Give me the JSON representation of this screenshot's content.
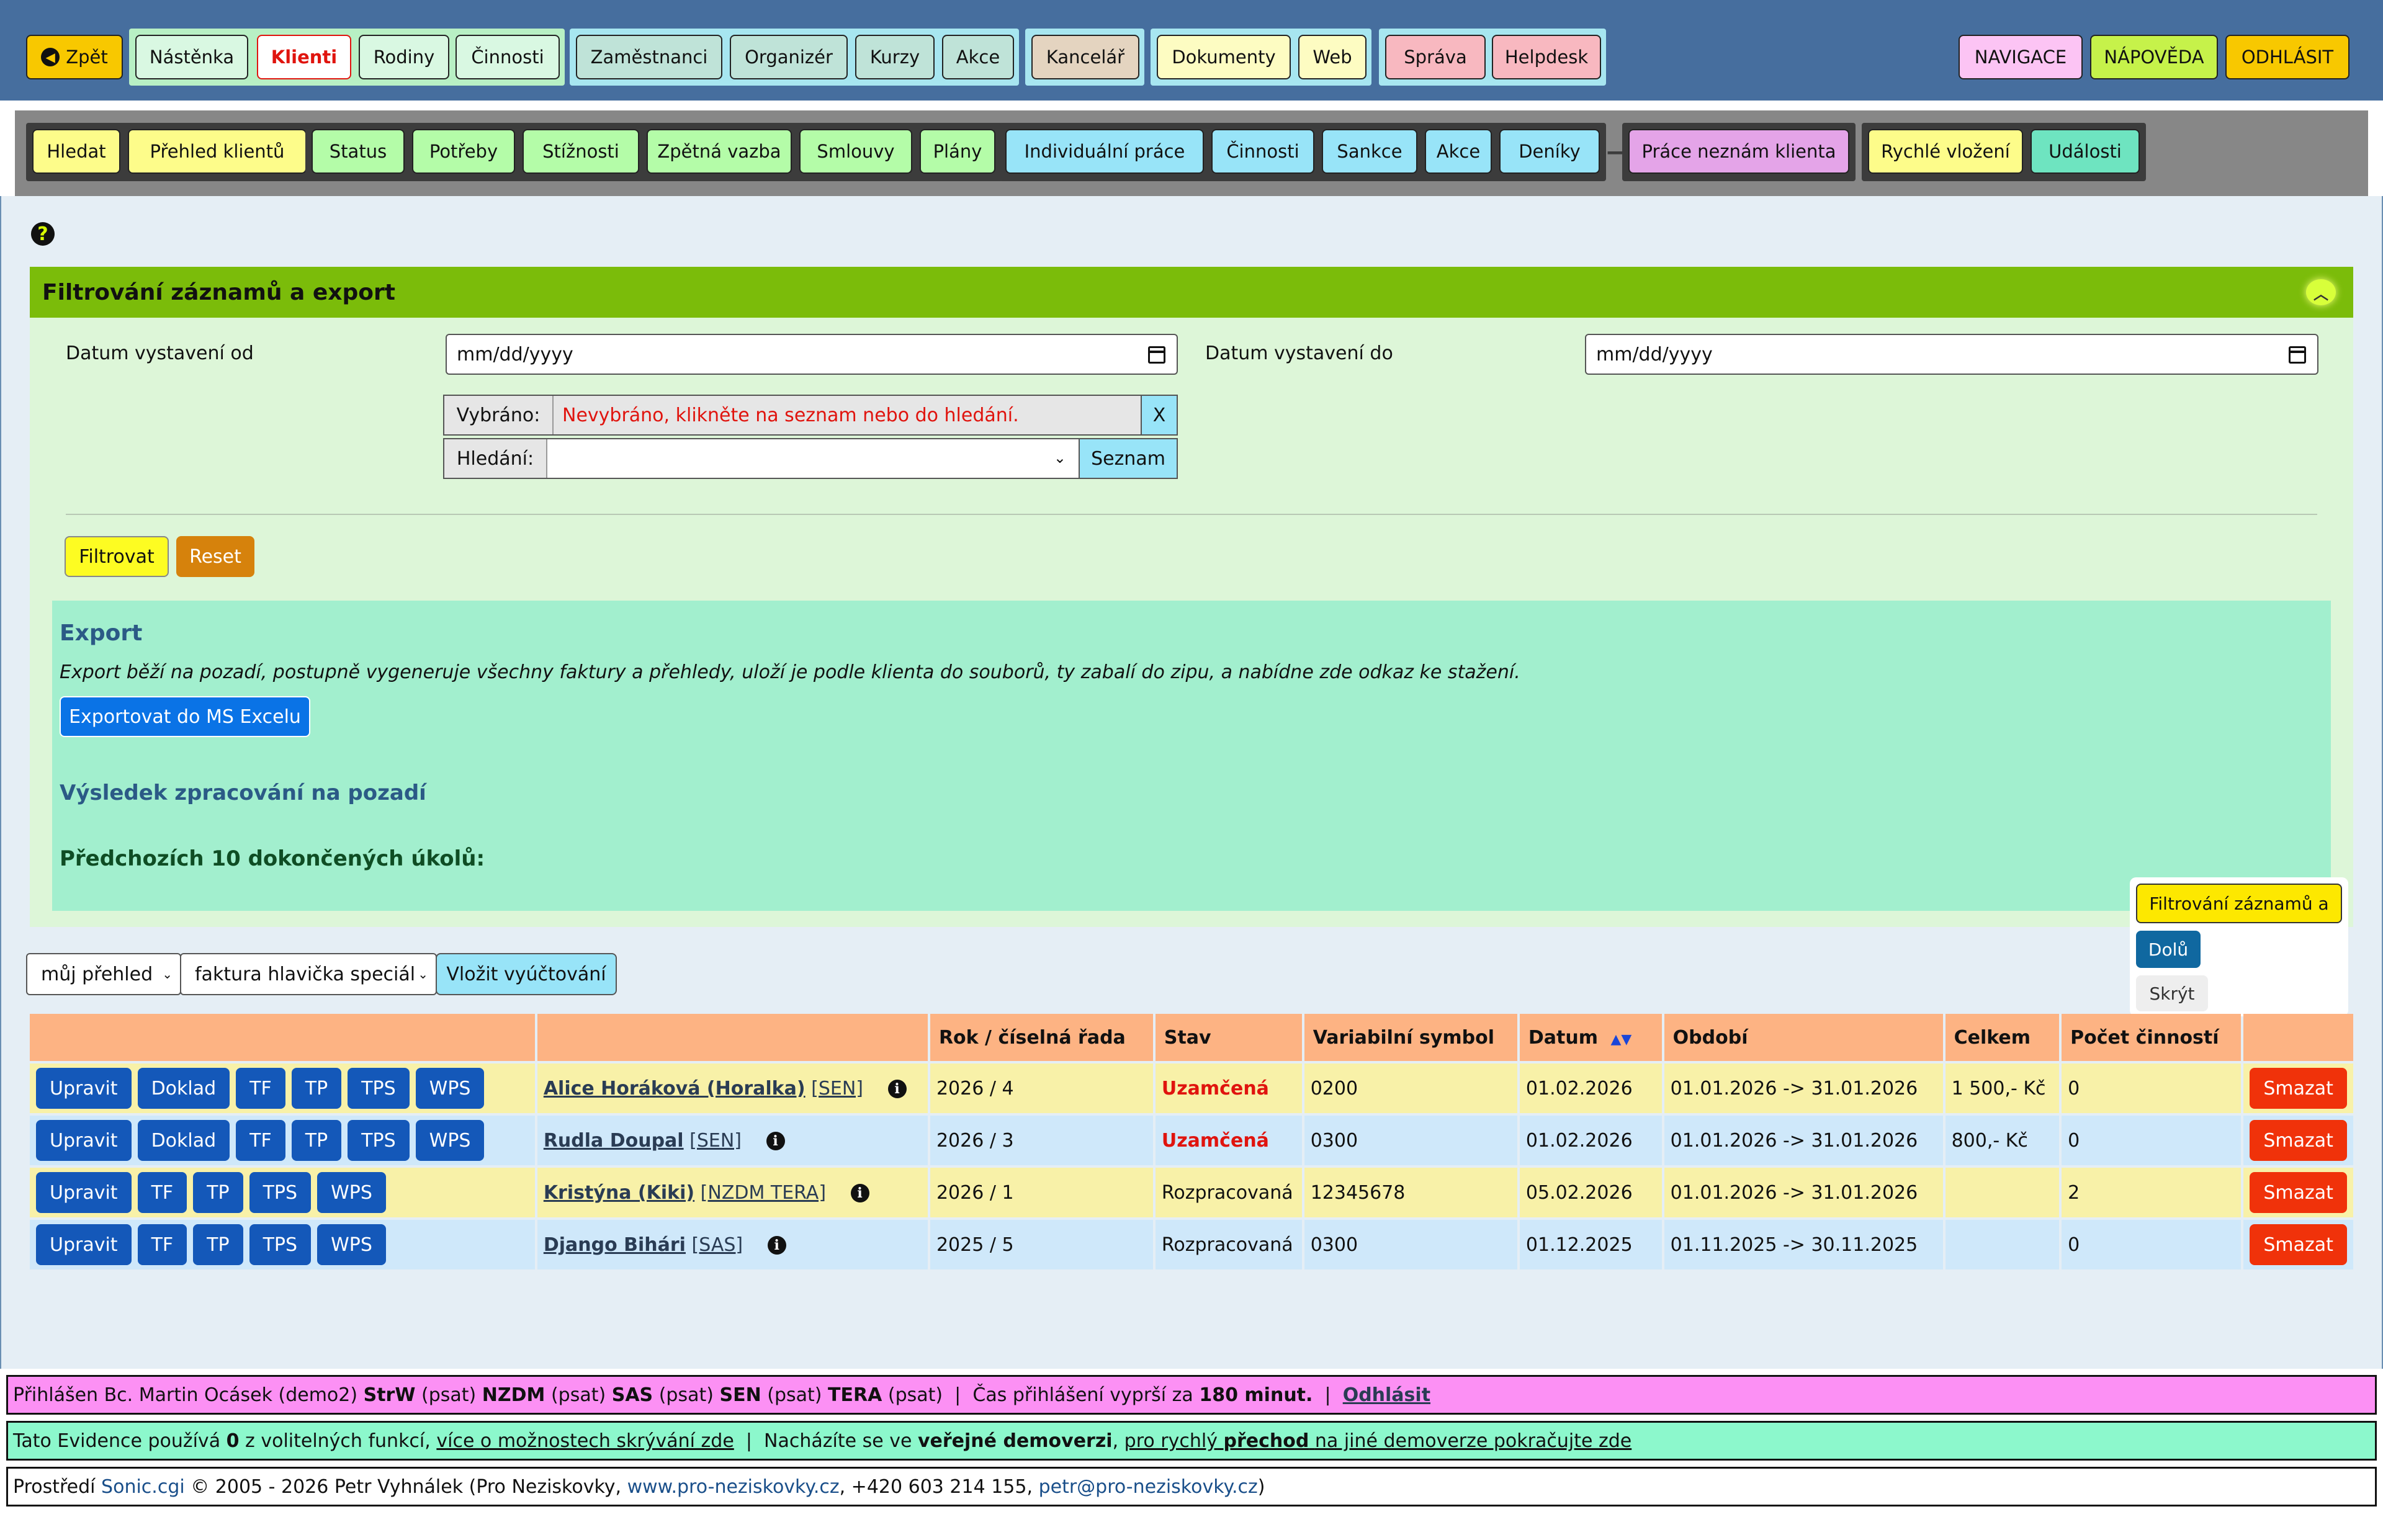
{
  "topnav": {
    "back": "Zpět",
    "groups": [
      {
        "items": [
          "Nástěnka",
          "Klienti",
          "Rodiny",
          "Činnosti"
        ]
      },
      {
        "items": [
          "Zaměstnanci",
          "Organizér",
          "Kurzy",
          "Akce"
        ]
      },
      {
        "items": [
          "Kancelář"
        ]
      },
      {
        "items": [
          "Dokumenty",
          "Web"
        ]
      },
      {
        "items": [
          "Správa",
          "Helpdesk"
        ]
      }
    ],
    "right": [
      "NAVIGACE",
      "NÁPOVĚDA",
      "ODHLÁSIT"
    ]
  },
  "subnav": {
    "g1": [
      "Hledat",
      "Přehled klientů"
    ],
    "g2": [
      "Status",
      "Potřeby",
      "Stížnosti",
      "Zpětná vazba",
      "Smlouvy",
      "Plány"
    ],
    "g3": [
      "Individuální práce",
      "Činnosti",
      "Sankce",
      "Akce",
      "Deníky"
    ],
    "sep": "−",
    "g4": [
      "Práce neznám klienta"
    ],
    "g5": [
      "Rychlé vložení",
      "Události"
    ]
  },
  "filter": {
    "title": "Filtrování záznamů a export",
    "date_from_label": "Datum vystavení od",
    "date_to_label": "Datum vystavení do",
    "date_placeholder": "mm/dd/yyyy",
    "selected_label": "Vybráno:",
    "selected_value": "Nevybráno, klikněte na seznam nebo do hledání.",
    "clear": "X",
    "search_label": "Hledání:",
    "list_btn": "Seznam",
    "filter_btn": "Filtrovat",
    "reset_btn": "Reset"
  },
  "export": {
    "title": "Export",
    "desc": "Export běží na pozadí, postupně vygeneruje všechny faktury a přehledy, uloží je podle klienta do souborů, ty zabalí do zipu, a nabídne zde odkaz ke stažení.",
    "button": "Exportovat do MS Excelu",
    "result_title": "Výsledek zpracování na pozadí",
    "prev_title": "Předchozích 10 dokončených úkolů:"
  },
  "floatmenu": {
    "first": "Filtrování záznamů a",
    "down": "Dolů",
    "hide": "Skrýt"
  },
  "controls": {
    "view_select": "můj přehled",
    "template_select": "faktura hlavička speciál",
    "insert_btn": "Vložit vyúčtování"
  },
  "table": {
    "headers": [
      "",
      "",
      "Rok / číselná řada",
      "Stav",
      "Variabilní symbol",
      "Datum",
      "Období",
      "Celkem",
      "Počet činností",
      ""
    ],
    "sort_arrows": "▲▼",
    "delete_label": "Smazat",
    "rows": [
      {
        "actions": [
          "Upravit",
          "Doklad",
          "TF",
          "TP",
          "TPS",
          "WPS"
        ],
        "name": "Alice Horáková (Horalka)",
        "tag": "[SEN]",
        "year": "2026 / 4",
        "state": "Uzamčená",
        "vs": "0200",
        "date": "01.02.2026",
        "period": "01.01.2026 -> 31.01.2026",
        "total": "1 500,- Kč",
        "count": "0"
      },
      {
        "actions": [
          "Upravit",
          "Doklad",
          "TF",
          "TP",
          "TPS",
          "WPS"
        ],
        "name": "Rudla Doupal",
        "tag": "[SEN]",
        "year": "2026 / 3",
        "state": "Uzamčená",
        "vs": "0300",
        "date": "01.02.2026",
        "period": "01.01.2026 -> 31.01.2026",
        "total": "800,- Kč",
        "count": "0"
      },
      {
        "actions": [
          "Upravit",
          "TF",
          "TP",
          "TPS",
          "WPS"
        ],
        "name": "Kristýna (Kiki)",
        "tag": "[NZDM TERA]",
        "year": "2026 / 1",
        "state": "Rozpracovaná",
        "vs": "12345678",
        "date": "05.02.2026",
        "period": "01.01.2026 -> 31.01.2026",
        "total": "",
        "count": "2"
      },
      {
        "actions": [
          "Upravit",
          "TF",
          "TP",
          "TPS",
          "WPS"
        ],
        "name": "Django Bihári",
        "tag": "[SAS]",
        "year": "2025 / 5",
        "state": "Rozpracovaná",
        "vs": "0300",
        "date": "01.12.2025",
        "period": "01.11.2025 -> 30.11.2025",
        "total": "",
        "count": "0"
      }
    ]
  },
  "footer": {
    "login_line": {
      "prefix": "Přihlášen Bc. Martin Ocásek (demo2)",
      "roles": [
        [
          "StrW",
          "(psat)"
        ],
        [
          "NZDM",
          "(psat)"
        ],
        [
          "SAS",
          "(psat)"
        ],
        [
          "SEN",
          "(psat)"
        ],
        [
          "TERA",
          "(psat)"
        ]
      ],
      "expiry_text": "Čas přihlášení vyprší za",
      "expiry_value": "180 minut.",
      "logout": "Odhlásit"
    },
    "info_line": {
      "t1": "Tato Evidence používá",
      "count": "0",
      "t2": "z volitelných funkcí,",
      "link1": "více o možnostech skrývání zde",
      "t3": "Nacházíte se ve",
      "bold": "veřejné demoverzi",
      "link2a": "pro rychlý",
      "link2b": "přechod",
      "link2c": "na jiné demoverze pokračujte zde"
    },
    "copyright": {
      "t1": "Prostředí",
      "sonic": "Sonic.cgi",
      "t2": "© 2005 - 2026 Petr Vyhnálek (Pro Neziskovky,",
      "web": "www.pro-neziskovky.cz",
      "t3": ", +420 603 214 155,",
      "email": "petr@pro-neziskovky.cz",
      "t4": ")"
    }
  }
}
